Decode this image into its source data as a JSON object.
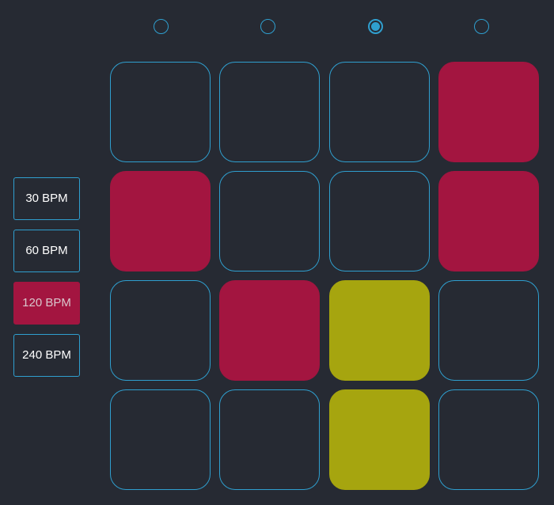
{
  "colors": {
    "background": "#262a33",
    "outline": "#2f9fcf",
    "red": "#a31540",
    "yellow": "#a6a50f"
  },
  "steps": {
    "count": 4,
    "active_index": 2
  },
  "bpm_options": [
    {
      "label": "30 BPM",
      "active": false
    },
    {
      "label": "60 BPM",
      "active": false
    },
    {
      "label": "120 BPM",
      "active": true
    },
    {
      "label": "240 BPM",
      "active": false
    }
  ],
  "grid": {
    "rows": [
      [
        "off",
        "off",
        "off",
        "red"
      ],
      [
        "red",
        "off",
        "off",
        "red"
      ],
      [
        "off",
        "red",
        "yellow",
        "off"
      ],
      [
        "off",
        "off",
        "yellow",
        "off"
      ]
    ]
  }
}
